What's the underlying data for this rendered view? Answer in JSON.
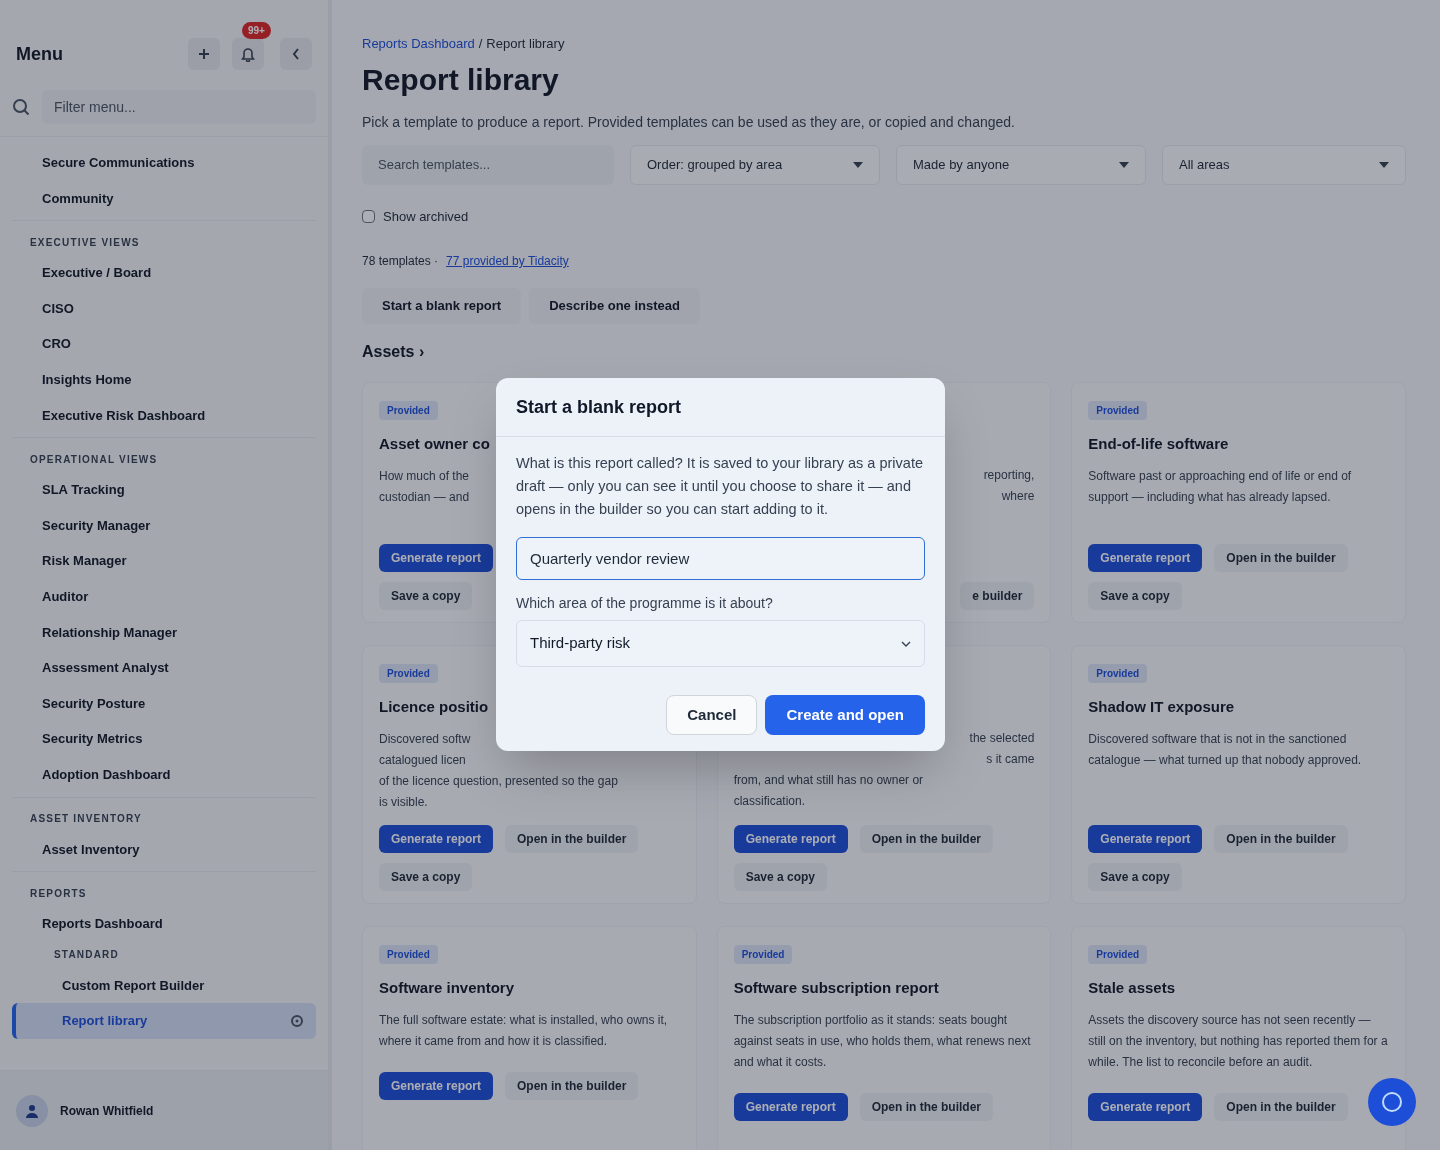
{
  "sidebar": {
    "title": "Menu",
    "notification_badge": "99+",
    "filter": {
      "placeholder": "Filter menu..."
    },
    "groups": [
      {
        "items": [
          {
            "label": "Secure Communications",
            "selected": false
          },
          {
            "label": "Community",
            "selected": false
          }
        ]
      },
      {
        "heading": "EXECUTIVE VIEWS",
        "items": [
          {
            "label": "Executive / Board",
            "selected": false
          },
          {
            "label": "CISO",
            "selected": false
          },
          {
            "label": "CRO",
            "selected": false
          },
          {
            "label": "Insights Home",
            "selected": false
          },
          {
            "label": "Executive Risk Dashboard",
            "selected": false
          }
        ]
      },
      {
        "heading": "OPERATIONAL VIEWS",
        "items": [
          {
            "label": "SLA Tracking",
            "selected": false
          },
          {
            "label": "Security Manager",
            "selected": false
          },
          {
            "label": "Risk Manager",
            "selected": false
          },
          {
            "label": "Auditor",
            "selected": false
          },
          {
            "label": "Relationship Manager",
            "selected": false
          },
          {
            "label": "Assessment Analyst",
            "selected": false
          },
          {
            "label": "Security Posture",
            "selected": false
          },
          {
            "label": "Security Metrics",
            "selected": false
          },
          {
            "label": "Adoption Dashboard",
            "selected": false
          }
        ]
      },
      {
        "heading": "ASSET INVENTORY",
        "items": [
          {
            "label": "Asset Inventory",
            "selected": false
          }
        ]
      },
      {
        "heading": "REPORTS",
        "items": [
          {
            "label": "Reports Dashboard",
            "selected": false
          }
        ],
        "subgroup": {
          "heading": "STANDARD",
          "items": [
            {
              "label": "Custom Report Builder",
              "selected": false
            },
            {
              "label": "Report library",
              "selected": true
            }
          ]
        }
      }
    ],
    "user": {
      "name": "Rowan Whitfield"
    }
  },
  "page": {
    "breadcrumb": [
      {
        "label": "Reports Dashboard",
        "kind": "link"
      },
      {
        "label": "Report library",
        "kind": "current"
      }
    ],
    "breadcrumb_separator": "/",
    "title": "Report library",
    "subtitle": "Pick a template to produce a report. Provided templates can be used as they are, or copied and changed.",
    "search": {
      "placeholder": "Search templates..."
    },
    "filters": [
      "Order: grouped by area",
      "Made by anyone",
      "All areas"
    ],
    "show_archived": {
      "label": "Show archived",
      "checked": false
    },
    "count": "78 templates ·",
    "count_link": "77 provided by Tidacity",
    "actions": [
      "Start a blank report",
      "Describe one instead"
    ],
    "section": "Assets ›",
    "cards": [
      {
        "badge": "Provided",
        "title": "Asset owner co",
        "lines": [
          {
            "text": "How much of the"
          },
          {
            "text": "custodian — and"
          }
        ],
        "button_rows": [
          [
            {
              "label": "Generate report",
              "kind": "primary"
            }
          ],
          [
            {
              "label": "Save a copy",
              "kind": "secondary"
            }
          ]
        ]
      },
      {
        "lines": [
          {
            "text": "reporting,",
            "cut": true
          },
          {
            "text": "where",
            "cut": true
          }
        ],
        "button_rows": [
          [
            {
              "label": "e builder",
              "kind": "secondary",
              "cut": true
            }
          ]
        ]
      },
      {
        "badge": "Provided",
        "title": "End-of-life software",
        "description": "Software past or approaching end of life or end of support — including what has already lapsed.",
        "button_rows": [
          [
            {
              "label": "Generate report",
              "kind": "primary"
            },
            {
              "label": "Open in the builder",
              "kind": "secondary"
            }
          ],
          [
            {
              "label": "Save a copy",
              "kind": "secondary"
            }
          ]
        ]
      },
      {
        "badge": "Provided",
        "title": "Licence positio",
        "lines": [
          {
            "text": "Discovered softw"
          },
          {
            "text": "catalogued licen"
          },
          {
            "text": "of the licence question, presented so the gap"
          },
          {
            "text": "is visible."
          }
        ],
        "button_rows": [
          [
            {
              "label": "Generate report",
              "kind": "primary"
            },
            {
              "label": "Open in the builder",
              "kind": "secondary"
            }
          ],
          [
            {
              "label": "Save a copy",
              "kind": "secondary"
            }
          ]
        ]
      },
      {
        "lines": [
          {
            "text": "the selected",
            "cut": true
          },
          {
            "text": "s it came",
            "cut": true
          },
          {
            "text": "from, and what still has no owner or"
          },
          {
            "text": "classification."
          }
        ],
        "button_rows": [
          [
            {
              "label": "Generate report",
              "kind": "primary"
            },
            {
              "label": "Open in the builder",
              "kind": "secondary"
            }
          ],
          [
            {
              "label": "Save a copy",
              "kind": "secondary"
            }
          ]
        ]
      },
      {
        "badge": "Provided",
        "title": "Shadow IT exposure",
        "description": "Discovered software that is not in the sanctioned catalogue — what turned up that nobody approved.",
        "button_rows": [
          [
            {
              "label": "Generate report",
              "kind": "primary"
            },
            {
              "label": "Open in the builder",
              "kind": "secondary"
            }
          ],
          [
            {
              "label": "Save a copy",
              "kind": "secondary"
            }
          ]
        ]
      },
      {
        "badge": "Provided",
        "title": "Software inventory",
        "description": "The full software estate: what is installed, who owns it, where it came from and how it is classified.",
        "button_rows": [
          [
            {
              "label": "Generate report",
              "kind": "primary"
            },
            {
              "label": "Open in the builder",
              "kind": "secondary"
            }
          ]
        ]
      },
      {
        "badge": "Provided",
        "title": "Software subscription report",
        "description": "The subscription portfolio as it stands: seats bought against seats in use, who holds them, what renews next and what it costs.",
        "button_rows": [
          [
            {
              "label": "Generate report",
              "kind": "primary"
            },
            {
              "label": "Open in the builder",
              "kind": "secondary"
            }
          ]
        ]
      },
      {
        "badge": "Provided",
        "title": "Stale assets",
        "description": "Assets the discovery source has not seen recently — still on the inventory, but nothing has reported them for a while. The list to reconcile before an audit.",
        "button_rows": [
          [
            {
              "label": "Generate report",
              "kind": "primary"
            },
            {
              "label": "Open in the builder",
              "kind": "secondary"
            }
          ]
        ]
      }
    ]
  },
  "dialog": {
    "title": "Start a blank report",
    "text": "What is this report called? It is saved to your library as a private draft — only you can see it until you choose to share it — and opens in the builder so you can start adding to it.",
    "name_field": {
      "value": "Quarterly vendor review"
    },
    "area_label": "Which area of the programme is it about?",
    "area_select": {
      "value": "Third-party risk"
    },
    "buttons": [
      {
        "label": "Cancel",
        "kind": "secondary"
      },
      {
        "label": "Create and open",
        "kind": "primary"
      }
    ]
  }
}
